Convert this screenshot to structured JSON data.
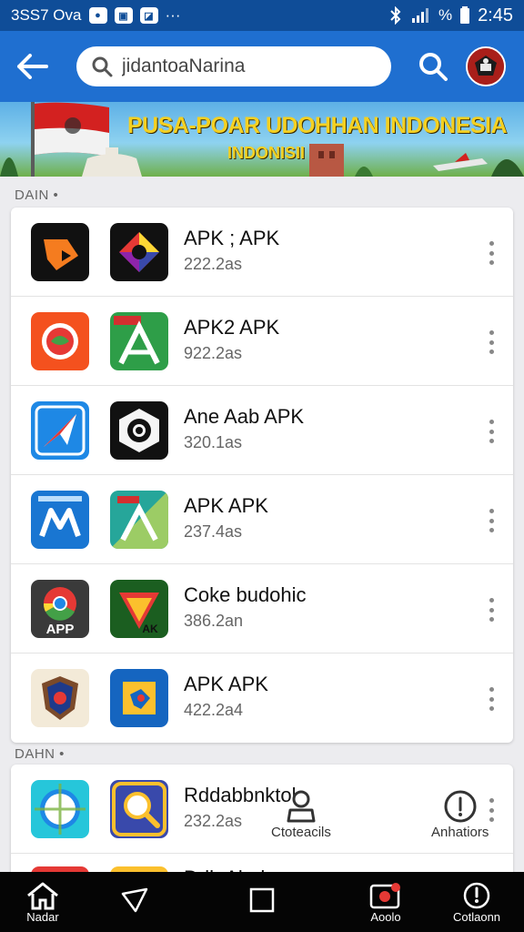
{
  "status_bar": {
    "left_text": "3SS7 Ova",
    "time": "2:45",
    "signal_text": "%"
  },
  "search": {
    "value": "jidantoaNarina",
    "placeholder": ""
  },
  "banner": {
    "title": "PUSA-POAR UDOHHAN INDONESIA",
    "subtitle": "INDONISII"
  },
  "sections": [
    {
      "label": "DAIN •",
      "items": [
        {
          "title": "APK ; APK",
          "subtitle": "222.2as"
        },
        {
          "title": "APK2 APK",
          "subtitle": "922.2as"
        },
        {
          "title": "Ane Aab APK",
          "subtitle": "320.1as"
        },
        {
          "title": "APK APK",
          "subtitle": "237.4as"
        },
        {
          "title": "Coke budohic",
          "subtitle": "386.2an"
        },
        {
          "title": "APK APK",
          "subtitle": "422.2a4"
        }
      ]
    },
    {
      "label": "DAHN •",
      "items": [
        {
          "title": "Rddabbnktol",
          "subtitle": "232.2as"
        },
        {
          "title": "Ddh Abah",
          "subtitle": ""
        }
      ]
    }
  ],
  "floating_actions": [
    {
      "label": "Ctoteacils",
      "icon": "user-bag-icon"
    },
    {
      "label": "Anhatiors",
      "icon": "alert-circle-icon"
    }
  ],
  "bottom_nav": [
    {
      "label": "Nadar",
      "icon": "home-icon"
    },
    {
      "label": "",
      "icon": "back-triangle-icon"
    },
    {
      "label": "",
      "icon": "recents-square-icon"
    },
    {
      "label": "Aoolo",
      "icon": "camera-badge-icon"
    },
    {
      "label": "Cotlaonn",
      "icon": "info-circle-icon"
    }
  ],
  "colors": {
    "status_bar": "#0f4d98",
    "app_bar": "#1f6fd0",
    "background": "#ececef",
    "nav_bar": "#050505",
    "banner_text": "#f4d021"
  }
}
